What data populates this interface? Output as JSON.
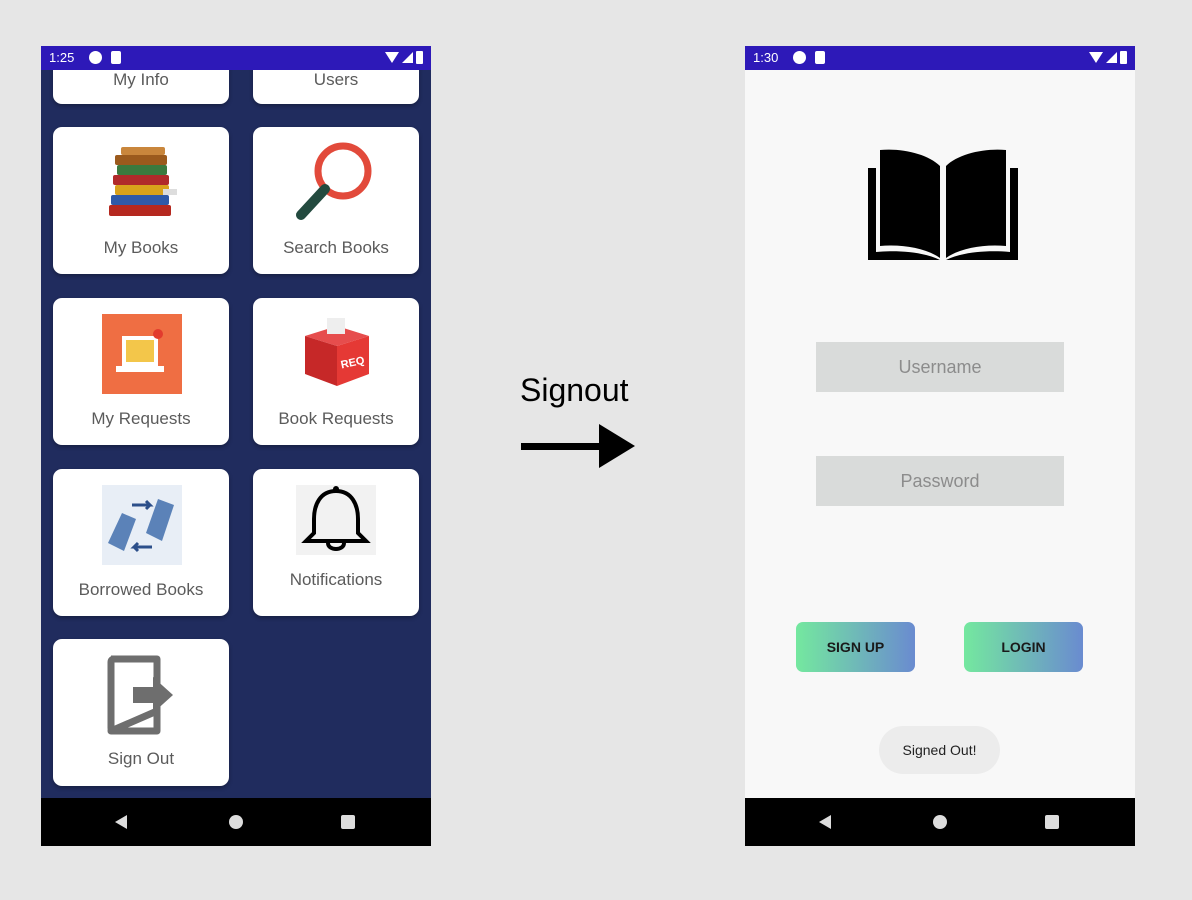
{
  "caption": {
    "text": "Signout"
  },
  "left_screen": {
    "status_time": "1:25",
    "tiles": [
      {
        "label": "My Info",
        "icon": "person-icon"
      },
      {
        "label": "Users",
        "icon": "users-icon"
      },
      {
        "label": "My Books",
        "icon": "book-stack-icon"
      },
      {
        "label": "Search Books",
        "icon": "magnifier-icon"
      },
      {
        "label": "My Requests",
        "icon": "laptop-mail-icon"
      },
      {
        "label": "Book Requests",
        "icon": "requests-box-icon"
      },
      {
        "label": "Borrowed Books",
        "icon": "book-exchange-icon"
      },
      {
        "label": "Notifications",
        "icon": "bell-icon"
      },
      {
        "label": "Sign Out",
        "icon": "sign-out-icon"
      }
    ]
  },
  "right_screen": {
    "status_time": "1:30",
    "logo_icon": "open-book-icon",
    "username_placeholder": "Username",
    "password_placeholder": "Password",
    "signup_label": "SIGN UP",
    "login_label": "LOGIN",
    "toast": "Signed Out!"
  },
  "colors": {
    "status_bar": "#2d19b8",
    "dashboard_bg": "#202c5e",
    "tile_bg": "#ffffff",
    "button_gradient_start": "#74e89f",
    "button_gradient_end": "#6a8bd0"
  }
}
